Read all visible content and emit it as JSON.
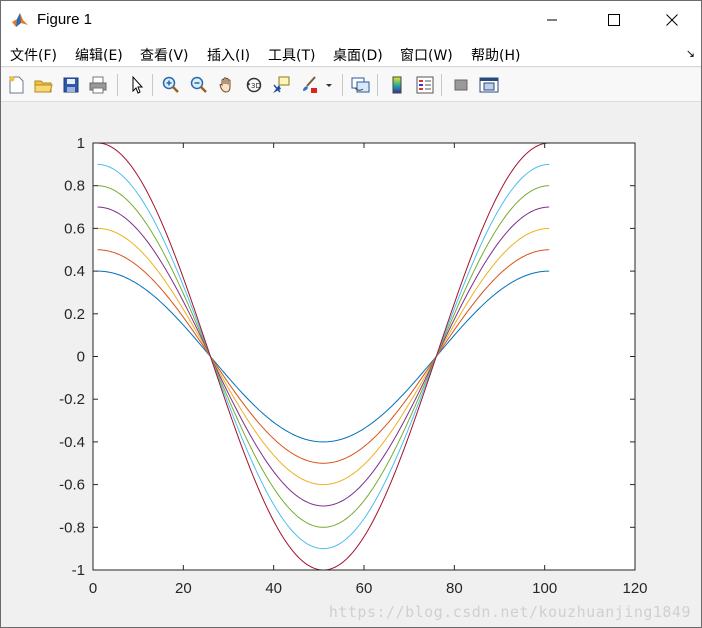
{
  "window": {
    "title": "Figure 1",
    "controls": {
      "minimize": "minimize",
      "maximize": "maximize",
      "close": "close"
    }
  },
  "menu": {
    "items": [
      {
        "label": "文件(F)"
      },
      {
        "label": "编辑(E)"
      },
      {
        "label": "查看(V)"
      },
      {
        "label": "插入(I)"
      },
      {
        "label": "工具(T)"
      },
      {
        "label": "桌面(D)"
      },
      {
        "label": "窗口(W)"
      },
      {
        "label": "帮助(H)"
      }
    ],
    "corner_glyph": "↘"
  },
  "toolbar": {
    "icons": [
      "new-figure-icon",
      "open-folder-icon",
      "save-icon",
      "print-icon",
      "pointer-icon",
      "zoom-in-icon",
      "zoom-out-icon",
      "pan-hand-icon",
      "rotate-3d-icon",
      "data-cursor-icon",
      "brush-icon",
      "link-plot-icon",
      "colorbar-icon",
      "legend-icon",
      "hide-plot-tools-icon",
      "show-plot-tools-icon"
    ]
  },
  "watermark": "https://blog.csdn.net/kouzhuanjing1849",
  "colors": {
    "axes_bg": "#ffffff",
    "figure_bg": "#f0f0f0",
    "series": [
      "#0072bd",
      "#d95319",
      "#edb120",
      "#7e2f8e",
      "#77ac30",
      "#4dbeee",
      "#a2142f"
    ]
  },
  "chart_data": {
    "type": "line",
    "title": "",
    "xlabel": "",
    "ylabel": "",
    "xlim": [
      0,
      120
    ],
    "ylim": [
      -1,
      1
    ],
    "xticks": [
      0,
      20,
      40,
      60,
      80,
      100,
      120
    ],
    "yticks": [
      -1,
      -0.8,
      -0.6,
      -0.4,
      -0.2,
      0,
      0.2,
      0.4,
      0.6,
      0.8,
      1
    ],
    "xtick_labels": [
      "0",
      "20",
      "40",
      "60",
      "80",
      "100",
      "120"
    ],
    "ytick_labels": [
      "-1",
      "-0.8",
      "-0.6",
      "-0.4",
      "-0.2",
      "0",
      "0.2",
      "0.4",
      "0.6",
      "0.8",
      "1"
    ],
    "grid": false,
    "legend": null,
    "x": [
      1,
      11,
      21,
      26,
      31,
      41,
      51,
      61,
      71,
      76,
      81,
      91,
      101
    ],
    "series": [
      {
        "amplitude": 0.4,
        "values": [
          0.4,
          0.324,
          0.124,
          0,
          -0.124,
          -0.324,
          -0.4,
          -0.324,
          -0.124,
          0,
          0.124,
          0.324,
          0.4
        ]
      },
      {
        "amplitude": 0.5,
        "values": [
          0.5,
          0.405,
          0.155,
          0,
          -0.155,
          -0.405,
          -0.5,
          -0.405,
          -0.155,
          0,
          0.155,
          0.405,
          0.5
        ]
      },
      {
        "amplitude": 0.6,
        "values": [
          0.6,
          0.485,
          0.185,
          0,
          -0.185,
          -0.485,
          -0.6,
          -0.485,
          -0.185,
          0,
          0.185,
          0.485,
          0.6
        ]
      },
      {
        "amplitude": 0.7,
        "values": [
          0.7,
          0.566,
          0.216,
          0,
          -0.216,
          -0.566,
          -0.7,
          -0.566,
          -0.216,
          0,
          0.216,
          0.566,
          0.7
        ]
      },
      {
        "amplitude": 0.8,
        "values": [
          0.8,
          0.647,
          0.247,
          0,
          -0.247,
          -0.647,
          -0.8,
          -0.647,
          -0.247,
          0,
          0.247,
          0.647,
          0.8
        ]
      },
      {
        "amplitude": 0.9,
        "values": [
          0.9,
          0.728,
          0.278,
          0,
          -0.278,
          -0.728,
          -0.9,
          -0.728,
          -0.278,
          0,
          0.278,
          0.728,
          0.9
        ]
      },
      {
        "amplitude": 1.0,
        "values": [
          1.0,
          0.809,
          0.309,
          0,
          -0.309,
          -0.809,
          -1.0,
          -0.809,
          -0.309,
          0,
          0.309,
          0.809,
          1.0
        ]
      }
    ],
    "function": "A*cos(2*pi*(x-1)/100), x = 1..101"
  }
}
